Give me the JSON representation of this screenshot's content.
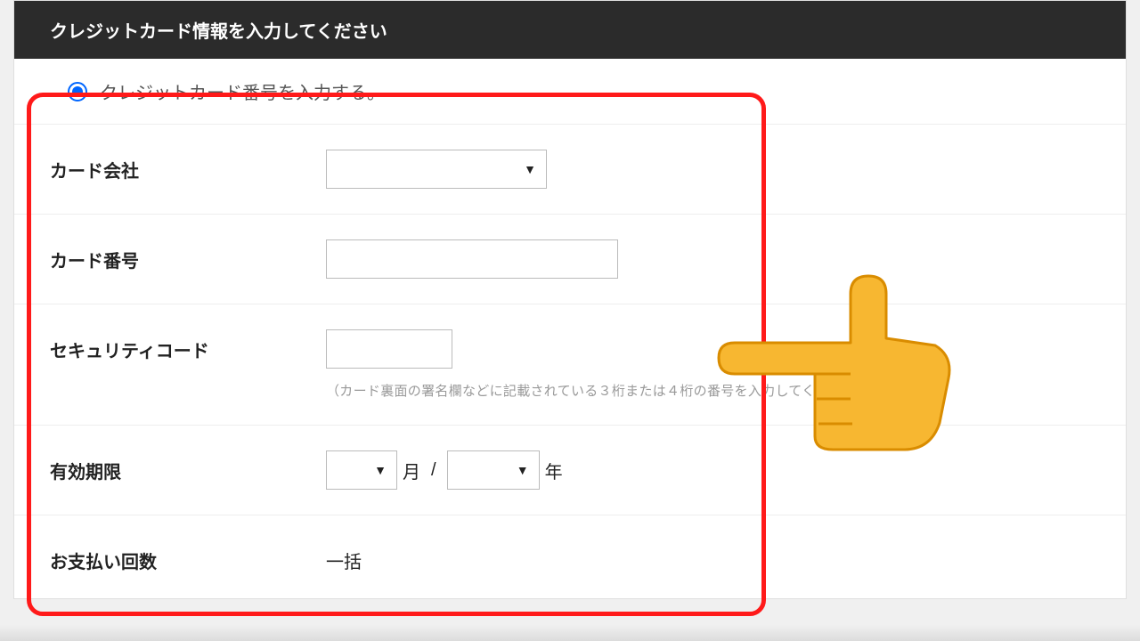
{
  "header": {
    "title": "クレジットカード情報を入力してください"
  },
  "radio": {
    "label": "クレジットカード番号を入力する。"
  },
  "fields": {
    "cardCompany": {
      "label": "カード会社"
    },
    "cardNumber": {
      "label": "カード番号"
    },
    "securityCode": {
      "label": "セキュリティコード",
      "helper": "（カード裏面の署名欄などに記載されている３桁または４桁の番号を入力してください）"
    },
    "expiry": {
      "label": "有効期限",
      "monthSuffix": "月",
      "separator": "/",
      "yearSuffix": "年"
    },
    "paymentCount": {
      "label": "お支払い回数",
      "value": "一括"
    }
  }
}
